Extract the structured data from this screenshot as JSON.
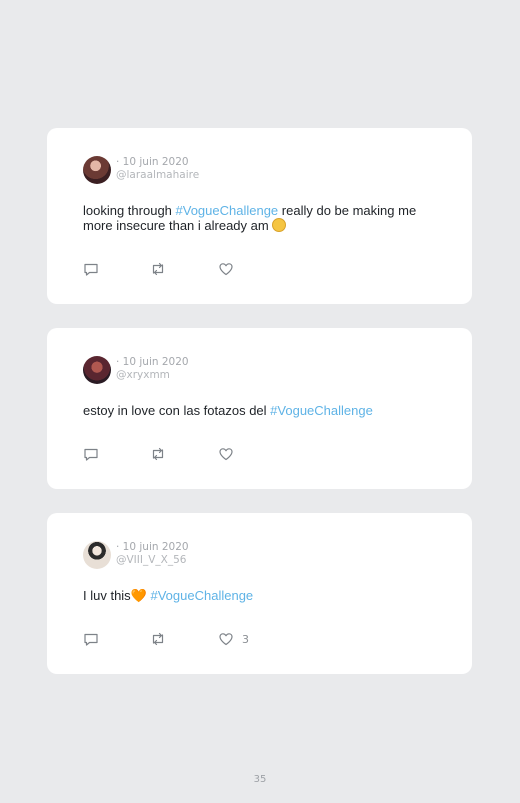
{
  "tweets": [
    {
      "date": "· 10 juin 2020",
      "handle": "@laraalmahaire",
      "text_before": "looking through ",
      "hashtag": "#VogueChallenge",
      "text_after": " really do be making me more insecure than i already am",
      "emoji": "slightly-smiling-face",
      "likes": ""
    },
    {
      "date": "· 10 juin 2020",
      "handle": "@xryxmm",
      "text_before": "estoy in love con las fotazos del ",
      "hashtag": "#VogueChallenge",
      "text_after": "",
      "likes": ""
    },
    {
      "date": "· 10 juin 2020",
      "handle": "@VIII_V_X_56",
      "text_before": "I luv this",
      "emoji_char": "🧡",
      "hashtag": "#VogueChallenge",
      "text_after": "",
      "likes": "3"
    }
  ],
  "page": {
    "number": "35"
  },
  "colors": {
    "hashtag": "#5fb3e6",
    "background": "#e9eaec",
    "card": "#ffffff"
  }
}
